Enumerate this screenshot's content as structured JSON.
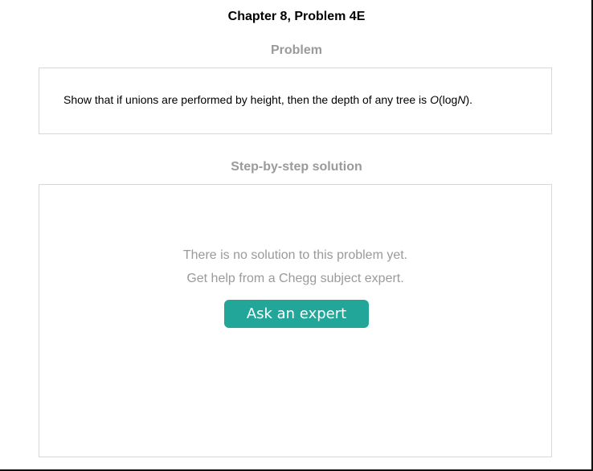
{
  "header": {
    "chapter_title": "Chapter 8, Problem 4E"
  },
  "problem": {
    "heading": "Problem",
    "text_before": "Show that if unions are performed by height, then the depth of any tree is ",
    "math_O": "O",
    "math_open": "(log",
    "math_N": "N",
    "math_close": ")."
  },
  "solution": {
    "heading": "Step-by-step solution",
    "no_solution_text": "There is no solution to this problem yet.",
    "help_text": "Get help from a Chegg subject expert.",
    "ask_button_label": "Ask an expert"
  },
  "colors": {
    "accent_button": "#22a69a",
    "heading_gray": "#9a9a9a",
    "border": "#d8d8d8"
  }
}
